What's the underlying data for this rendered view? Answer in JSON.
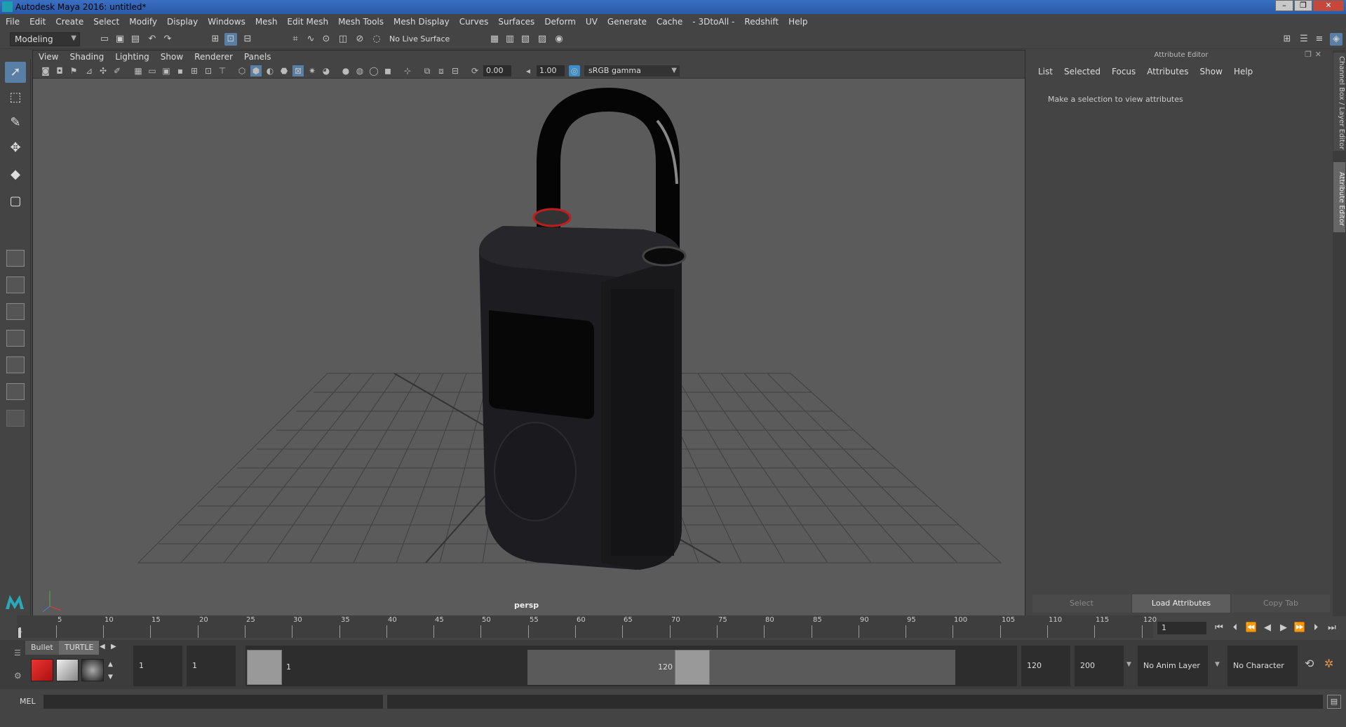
{
  "window": {
    "title": "Autodesk Maya 2016: untitled*",
    "controls": [
      "–",
      "❐",
      "✕"
    ]
  },
  "menu": [
    "File",
    "Edit",
    "Create",
    "Select",
    "Modify",
    "Display",
    "Windows",
    "Mesh",
    "Edit Mesh",
    "Mesh Tools",
    "Mesh Display",
    "Curves",
    "Surfaces",
    "Deform",
    "UV",
    "Generate",
    "Cache",
    "- 3DtoAll -",
    "Redshift",
    "Help"
  ],
  "toolbar": {
    "mode": "Modeling",
    "live_surface": "No Live Surface"
  },
  "viewport": {
    "menu": [
      "View",
      "Shading",
      "Lighting",
      "Show",
      "Renderer",
      "Panels"
    ],
    "exposure": "0.00",
    "gamma_value": "1.00",
    "color_space": "sRGB gamma",
    "camera": "persp"
  },
  "attribute_editor": {
    "title": "Attribute Editor",
    "menu": [
      "List",
      "Selected",
      "Focus",
      "Attributes",
      "Show",
      "Help"
    ],
    "message": "Make a selection to view attributes",
    "buttons": [
      "Select",
      "Load Attributes",
      "Copy Tab"
    ]
  },
  "side_tabs": [
    "Channel Box / Layer Editor",
    "Attribute Editor"
  ],
  "timeline": {
    "ticks": [
      "5",
      "10",
      "15",
      "20",
      "25",
      "30",
      "35",
      "40",
      "45",
      "50",
      "55",
      "60",
      "65",
      "70",
      "75",
      "80",
      "85",
      "90",
      "95",
      "100",
      "105",
      "110",
      "115",
      "120"
    ],
    "start_label": "1",
    "current_frame": "1"
  },
  "shelf": {
    "tabs": [
      "Bullet",
      "TURTLE"
    ],
    "range_start": "1",
    "playback_start": "1",
    "range_inner_start": "1",
    "range_inner_end": "120",
    "playback_end": "120",
    "range_end": "200",
    "anim_layer": "No Anim Layer",
    "character_set": "No Character Set"
  },
  "command_line": {
    "label": "MEL"
  },
  "colors": {
    "accent": "#5a7fa6",
    "title_bar": "#3a6fc2",
    "viewport_bg": "#5b5b5b"
  }
}
